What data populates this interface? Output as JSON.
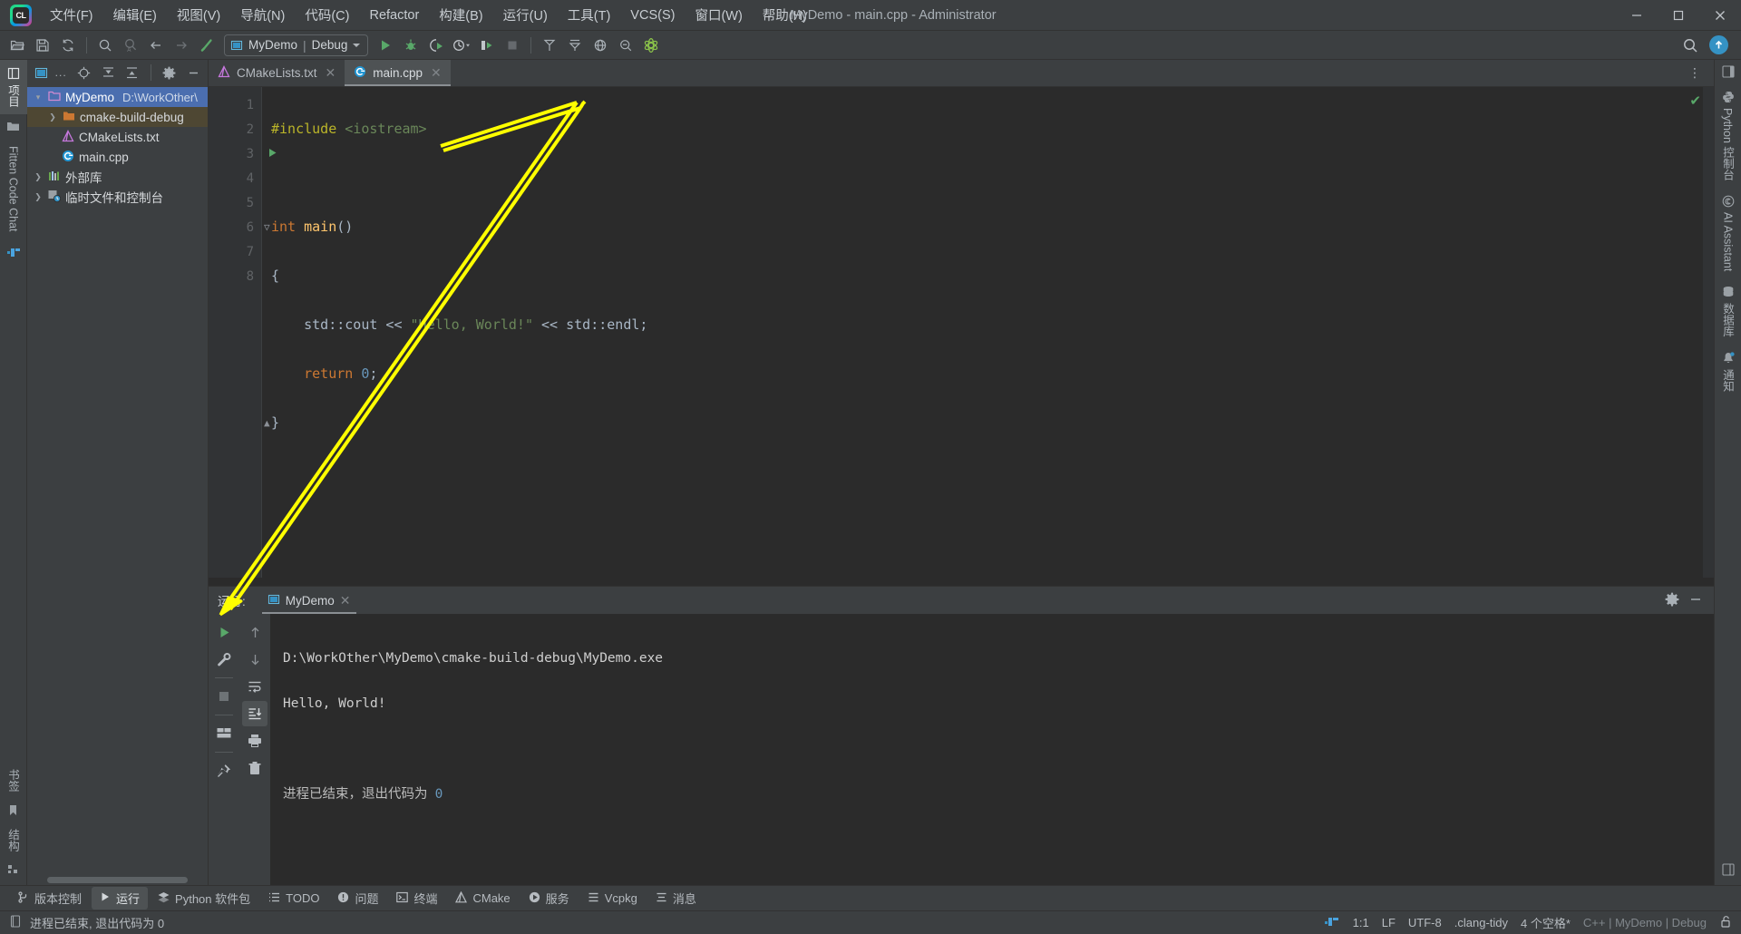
{
  "window": {
    "title": "MyDemo - main.cpp - Administrator",
    "logo_text": "CL",
    "minimize": "—",
    "maximize": "❐",
    "close": "✕"
  },
  "menu": [
    {
      "label": "文件(F)",
      "name": "menu-file"
    },
    {
      "label": "编辑(E)",
      "name": "menu-edit"
    },
    {
      "label": "视图(V)",
      "name": "menu-view"
    },
    {
      "label": "导航(N)",
      "name": "menu-navigate"
    },
    {
      "label": "代码(C)",
      "name": "menu-code"
    },
    {
      "label": "Refactor",
      "name": "menu-refactor"
    },
    {
      "label": "构建(B)",
      "name": "menu-build"
    },
    {
      "label": "运行(U)",
      "name": "menu-run"
    },
    {
      "label": "工具(T)",
      "name": "menu-tools"
    },
    {
      "label": "VCS(S)",
      "name": "menu-vcs"
    },
    {
      "label": "窗口(W)",
      "name": "menu-window"
    },
    {
      "label": "帮助(H)",
      "name": "menu-help"
    }
  ],
  "toolbar": {
    "run_config": {
      "project": "MyDemo",
      "separator": "|",
      "mode": "Debug"
    },
    "icons": [
      "open-folder-icon",
      "save-icon",
      "sync-icon",
      "search-icon",
      "search-structurally-icon",
      "back-arrow-icon",
      "forward-arrow-icon",
      "build-hammer-icon"
    ],
    "right_icons": [
      "search-everywhere-icon",
      "update-icon"
    ]
  },
  "left_rail": {
    "top": [
      {
        "label": "项目",
        "icon": "project-icon",
        "name": "rail-project",
        "active": true
      },
      {
        "label": "",
        "icon": "folder-icon",
        "name": "rail-folder",
        "active": false
      },
      {
        "label": "Fitten Code Chat",
        "icon": "",
        "name": "rail-fitten-chat",
        "active": false
      },
      {
        "label": "",
        "icon": "fitten-logo-icon",
        "name": "rail-fitten-logo",
        "active": false
      }
    ],
    "bottom": [
      {
        "label": "书签",
        "icon": "bookmark-icon",
        "name": "rail-bookmarks"
      },
      {
        "label": "结构",
        "icon": "structure-icon",
        "name": "rail-structure"
      }
    ]
  },
  "right_rail": {
    "items": [
      {
        "label": "Python 控制台",
        "icon": "python-icon",
        "name": "rail-python-console"
      },
      {
        "label": "AI Assistant",
        "icon": "ai-assistant-icon",
        "name": "rail-ai-assistant"
      },
      {
        "label": "数据库",
        "icon": "database-icon",
        "name": "rail-database"
      },
      {
        "label": "通知",
        "icon": "bell-icon",
        "name": "rail-notifications"
      }
    ]
  },
  "project_panel": {
    "header_icons": [
      "project-view-selector-icon",
      "locate-icon",
      "expand-all-icon",
      "collapse-all-icon",
      "settings-gear-icon",
      "hide-icon"
    ],
    "header_label": "...",
    "tree": [
      {
        "level": 0,
        "arrow": "▾",
        "icon": "module-folder-icon",
        "name": "MyDemo",
        "path": "D:\\WorkOther\\",
        "selected": true
      },
      {
        "level": 1,
        "arrow": "❯",
        "icon": "excluded-folder-icon",
        "name": "cmake-build-debug",
        "path": "",
        "highlight": true
      },
      {
        "level": 2,
        "arrow": "",
        "icon": "cmake-file-icon",
        "name": "CMakeLists.txt",
        "path": ""
      },
      {
        "level": 2,
        "arrow": "",
        "icon": "cpp-file-icon",
        "name": "main.cpp",
        "path": ""
      },
      {
        "level": 0,
        "arrow": "❯",
        "icon": "library-icon",
        "name": "外部库",
        "path": ""
      },
      {
        "level": 0,
        "arrow": "❯",
        "icon": "scratches-icon",
        "name": "临时文件和控制台",
        "path": ""
      }
    ]
  },
  "editor": {
    "tabs": [
      {
        "label": "CMakeLists.txt",
        "icon": "cmake-file-icon",
        "active": false
      },
      {
        "label": "main.cpp",
        "icon": "cpp-file-icon",
        "active": true
      }
    ],
    "line_numbers": [
      "1",
      "2",
      "3",
      "4",
      "5",
      "6",
      "7",
      "8"
    ],
    "lines": [
      [
        {
          "t": "#include ",
          "c": "inc"
        },
        {
          "t": "<iostream>",
          "c": "incf"
        }
      ],
      [],
      [
        {
          "t": "int",
          "c": "kw"
        },
        {
          "t": " ",
          "c": "op"
        },
        {
          "t": "main",
          "c": "fn"
        },
        {
          "t": "()",
          "c": "op"
        }
      ],
      [
        {
          "t": "{",
          "c": "op"
        }
      ],
      [
        {
          "t": "    std",
          "c": "id"
        },
        {
          "t": "::",
          "c": "op"
        },
        {
          "t": "cout",
          "c": "id"
        },
        {
          "t": " << ",
          "c": "op"
        },
        {
          "t": "\"Hello, World!\"",
          "c": "str"
        },
        {
          "t": " << ",
          "c": "op"
        },
        {
          "t": "std",
          "c": "id"
        },
        {
          "t": "::",
          "c": "op"
        },
        {
          "t": "endl",
          "c": "id"
        },
        {
          "t": ";",
          "c": "op"
        }
      ],
      [
        {
          "t": "    ",
          "c": "op"
        },
        {
          "t": "return",
          "c": "kw"
        },
        {
          "t": " ",
          "c": "op"
        },
        {
          "t": "0",
          "c": "num"
        },
        {
          "t": ";",
          "c": "op"
        }
      ],
      [
        {
          "t": "}",
          "c": "op"
        }
      ],
      []
    ],
    "inspection_status": "✔"
  },
  "run_panel": {
    "title": "运行:",
    "tab_label": "MyDemo",
    "tab_icon": "run-config-icon",
    "left_icons": [
      "rerun-play-icon",
      "wrench-settings-icon",
      "stop-icon",
      "layout-icon",
      "pin-icon"
    ],
    "right_icons": [
      "up-arrow-icon",
      "down-arrow-icon",
      "soft-wrap-icon",
      "scroll-to-end-icon",
      "print-icon",
      "trash-icon"
    ],
    "header_right_icons": [
      "settings-gear-icon",
      "minimize-icon"
    ],
    "console": {
      "command": "D:\\WorkOther\\MyDemo\\cmake-build-debug\\MyDemo.exe",
      "output": "Hello, World!",
      "blank": "",
      "exit_text": "进程已结束，退出代码为",
      "exit_code": "0"
    }
  },
  "bottom_strip": [
    {
      "label": "版本控制",
      "icon": "branch-icon",
      "active": false,
      "name": "tool-version-control"
    },
    {
      "label": "运行",
      "icon": "play-icon",
      "active": true,
      "name": "tool-run"
    },
    {
      "label": "Python 软件包",
      "icon": "packages-icon",
      "active": false,
      "name": "tool-python-packages"
    },
    {
      "label": "TODO",
      "icon": "todo-icon",
      "active": false,
      "name": "tool-todo"
    },
    {
      "label": "问题",
      "icon": "problems-icon",
      "active": false,
      "name": "tool-problems"
    },
    {
      "label": "终端",
      "icon": "terminal-icon",
      "active": false,
      "name": "tool-terminal"
    },
    {
      "label": "CMake",
      "icon": "cmake-icon",
      "active": false,
      "name": "tool-cmake"
    },
    {
      "label": "服务",
      "icon": "services-icon",
      "active": false,
      "name": "tool-services"
    },
    {
      "label": "Vcpkg",
      "icon": "vcpkg-icon",
      "active": false,
      "name": "tool-vcpkg"
    },
    {
      "label": "消息",
      "icon": "messages-icon",
      "active": false,
      "name": "tool-messages"
    }
  ],
  "status_bar": {
    "message": "进程已结束, 退出代码为 0",
    "message_icon": "console-icon",
    "fitten_icon": "fitten-logo-icon",
    "caret": "1:1",
    "line_sep": "LF",
    "encoding": "UTF-8",
    "inspection": ".clang-tidy",
    "indent": "4 个空格*",
    "context": "C++ | MyDemo | Debug",
    "lock_icon": "unlocked-icon"
  },
  "colors": {
    "accent_blue": "#3592c4",
    "selection_blue": "#4b6eaf",
    "green_run": "#59a869",
    "annotation_yellow": "#ffff00",
    "panel_bg": "#3c3f41",
    "editor_bg": "#2b2b2b",
    "gutter_bg": "#313335"
  }
}
